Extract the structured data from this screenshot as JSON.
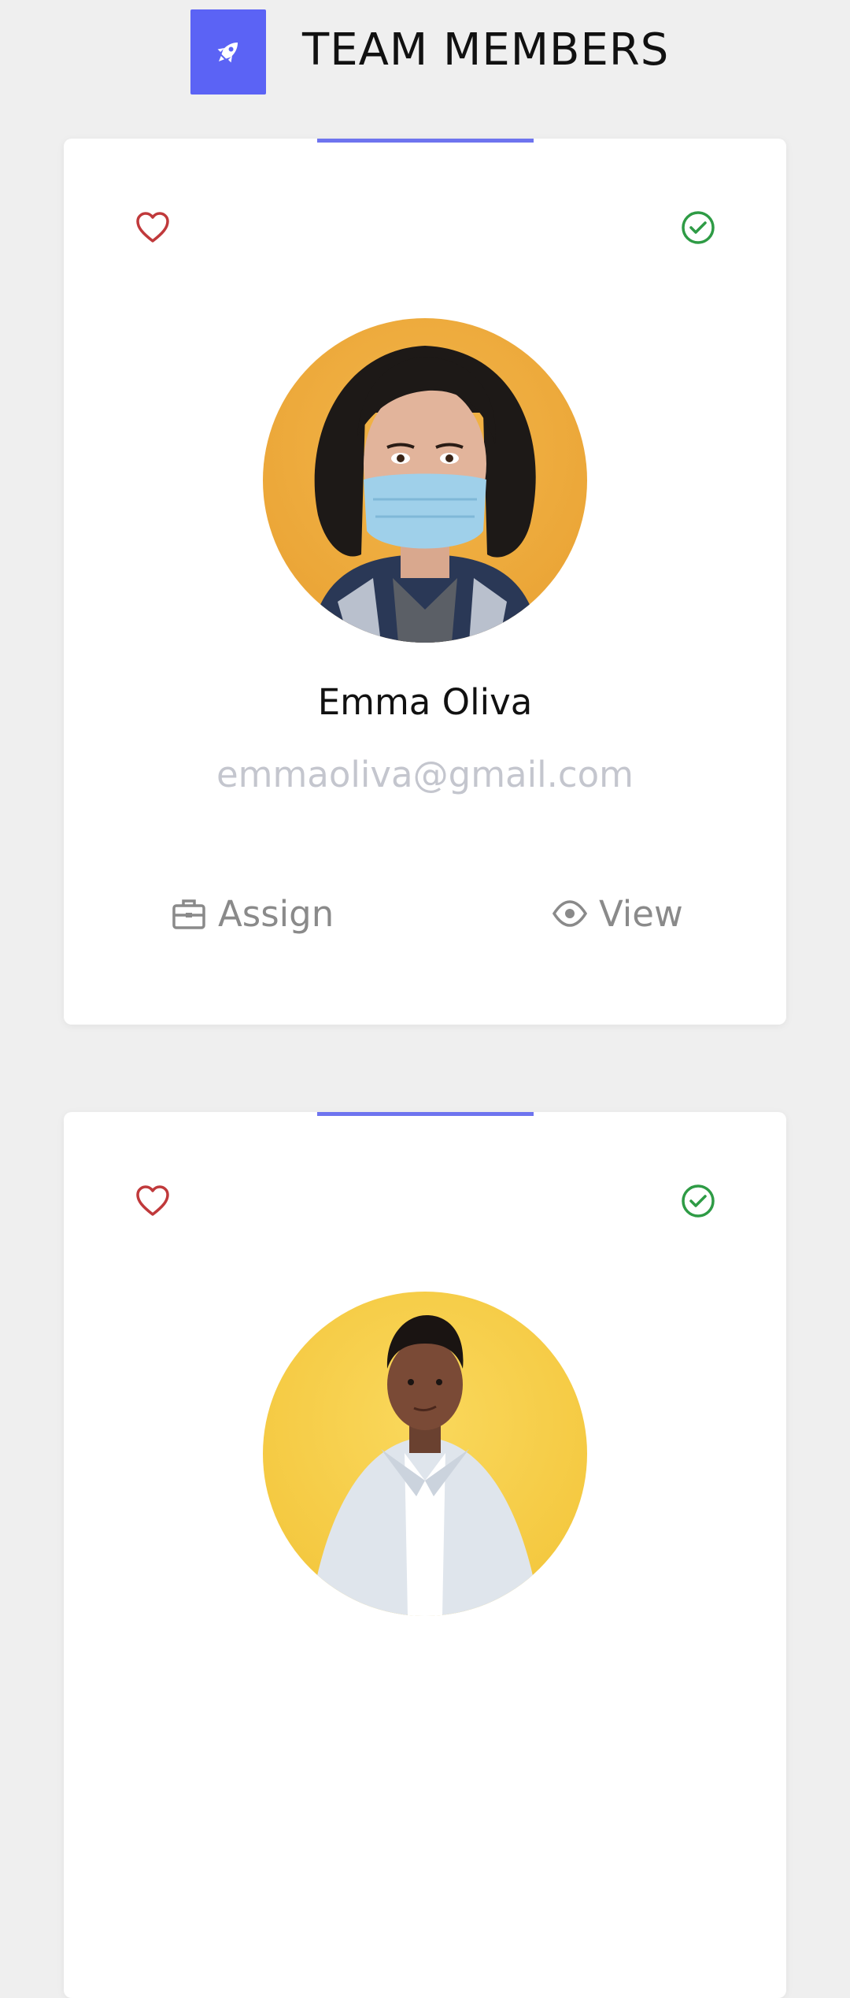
{
  "header": {
    "title": "TEAM MEMBERS",
    "logo_icon": "rocket-icon",
    "logo_color": "#5b63f5"
  },
  "members": [
    {
      "name": "Emma Oliva",
      "email": "emmaoliva@gmail.com",
      "favorite_icon": "heart-icon",
      "verified_icon": "check-circle-icon",
      "avatar_background": "#efab3a",
      "actions": {
        "assign_label": "Assign",
        "view_label": "View"
      }
    },
    {
      "avatar_background": "#f6cc45",
      "favorite_icon": "heart-icon",
      "verified_icon": "check-circle-icon"
    }
  ],
  "colors": {
    "accent": "#6e74ef",
    "favorite": "#c0393b",
    "verified": "#2e9b45",
    "muted_text": "#c4c6ce",
    "action_text": "#8a8a8a"
  }
}
